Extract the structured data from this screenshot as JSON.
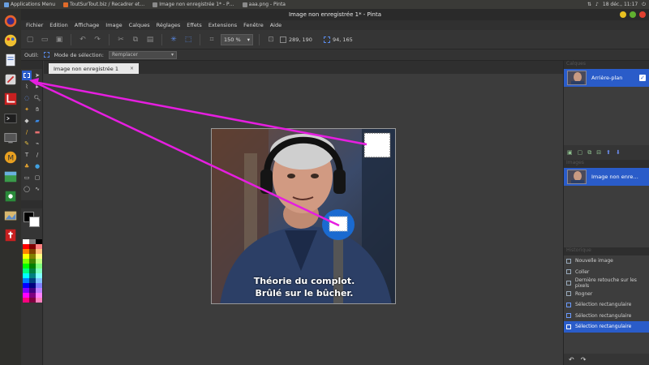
{
  "top_panel": {
    "apps_menu": "Applications Menu",
    "tasks": [
      "ToutSurTout.biz / Recadrer et…",
      "Image non enregistrée 1* - P…",
      "aaa.png - Pinta"
    ],
    "clock": "18 déc., 11:17"
  },
  "window": {
    "title": "Image non enregistrée 1* - Pinta"
  },
  "menu": [
    "Fichier",
    "Edition",
    "Affichage",
    "Image",
    "Calques",
    "Réglages",
    "Effets",
    "Extensions",
    "Fenêtre",
    "Aide"
  ],
  "toolbar": {
    "zoom": "150 %",
    "cursor_pos": "289, 190",
    "selection_size": "94, 165"
  },
  "options": {
    "tool_label": "Outil:",
    "mode_label": "Mode de sélection:",
    "mode_value": "Remplacer"
  },
  "tab": {
    "label": "Image non enregistrée 1",
    "close": "×"
  },
  "image": {
    "caption_line1": "Théorie du complot.",
    "caption_line2": "Brûlé sur le bûcher."
  },
  "layers": {
    "header": "Calques",
    "items": [
      {
        "name": "Arrière-plan",
        "checked": true
      }
    ]
  },
  "images_panel": {
    "header": "Images",
    "items": [
      "Image non enre…"
    ]
  },
  "history": {
    "header": "Historique",
    "items": [
      "Nouvelle image",
      "Coller",
      "Dernière retouche sur les pixels",
      "Rogner",
      "Sélection rectangulaire",
      "Sélection rectangulaire",
      "Sélection rectangulaire"
    ],
    "selected_index": 6,
    "undo": "↶",
    "redo": "↷"
  },
  "colors": {
    "accent": "#2a5cc9",
    "arrow": "#e61ee0",
    "primary": "#000000",
    "secondary": "#ffffff"
  }
}
